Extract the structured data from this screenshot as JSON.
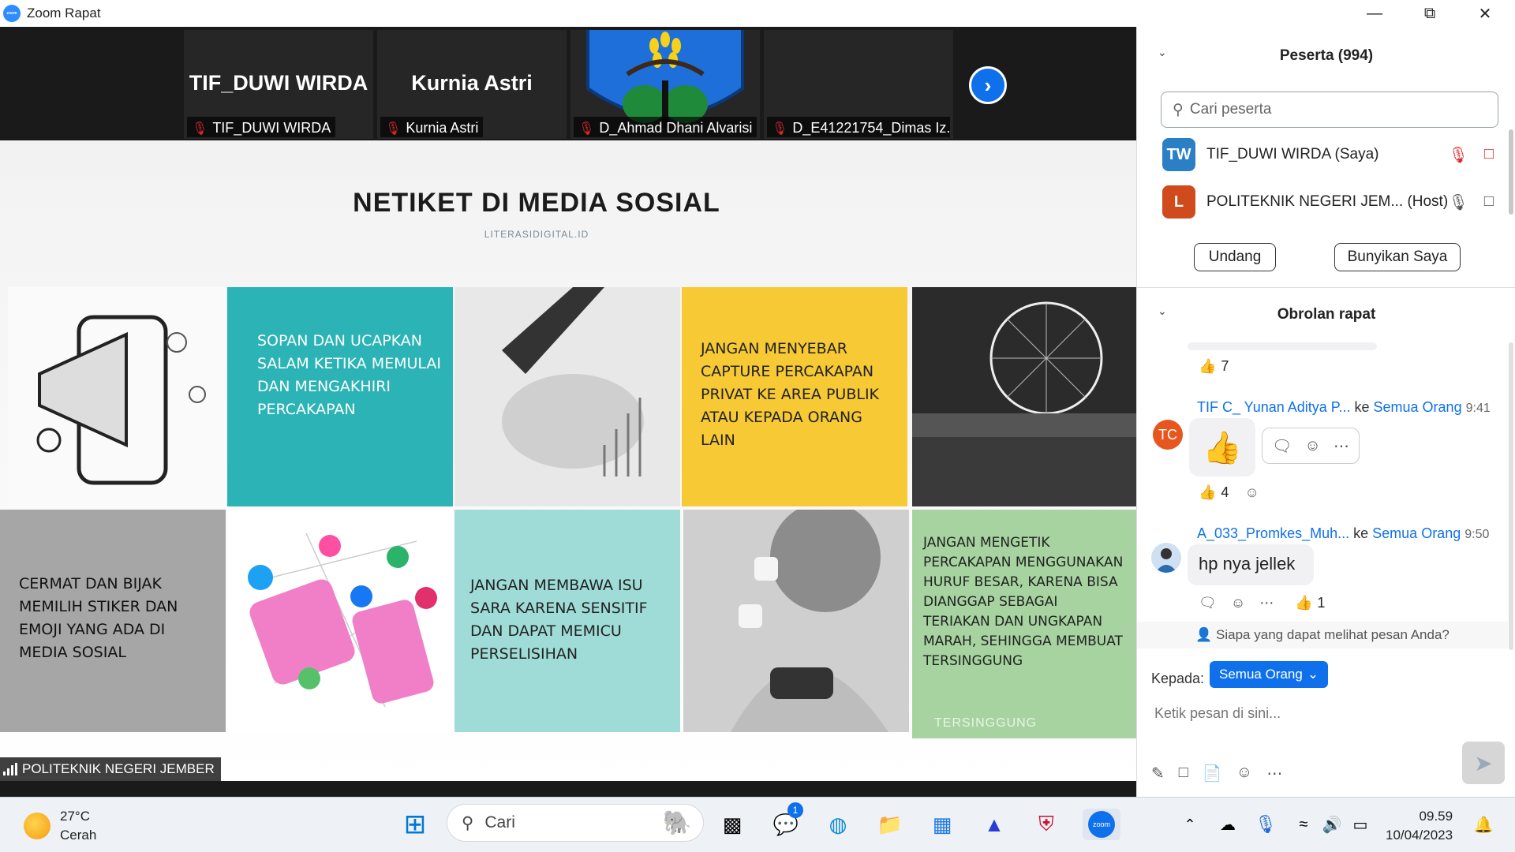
{
  "window": {
    "title": "Zoom Rapat",
    "logo_text": "zoom"
  },
  "video_strip": {
    "tiles": [
      {
        "display_name": "TIF_DUWI WIRDA",
        "label": "TIF_DUWI WIRDA"
      },
      {
        "display_name": "Kurnia Astri",
        "label": "Kurnia Astri"
      },
      {
        "display_name": "",
        "label": "D_Ahmad Dhani Alvarisi"
      },
      {
        "display_name": "",
        "label": "D_E41221754_Dimas Iz..."
      }
    ]
  },
  "slide": {
    "title": "NETIKET DI MEDIA SOSIAL",
    "subtitle": "LITERASIDIGITAL.ID",
    "tips": [
      "Sopan dan ucapkan salam ketika memulai dan mengakhiri percakapan",
      "Jangan menyebar capture percakapan privat ke area publik atau kepada orang lain",
      "Cermat dan bijak memilih stiker dan emoji yang ada di media sosial",
      "Jangan membawa isu SARA karena sensitif dan dapat memicu perselisihan",
      "Jangan mengetik percakapan menggunakan huruf besar, karena bisa dianggap sebagai teriakan dan ungkapan marah, sehingga membuat tersinggung"
    ],
    "watermark": "TERSINGGUNG",
    "speaker_label": "POLITEKNIK NEGERI JEMBER"
  },
  "participants": {
    "header": "Peserta (994)",
    "search_placeholder": "Cari peserta",
    "list": [
      {
        "initials": "TW",
        "name": "TIF_DUWI WIRDA (Saya)",
        "color": "#2b7fc4"
      },
      {
        "initials": "L",
        "name": "POLITEKNIK NEGERI JEM... (Host)",
        "color": "#d04a1b"
      }
    ],
    "invite_label": "Undang",
    "unmute_label": "Bunyikan Saya"
  },
  "chat": {
    "header": "Obrolan rapat",
    "messages": [
      {
        "reaction": "👍",
        "reaction_count": "7"
      },
      {
        "avatar": "TC",
        "sender": "TIF C_ Yunan Aditya P...",
        "to_word": "ke",
        "to": "Semua Orang",
        "time": "9:41",
        "content": "👍",
        "reaction": "👍",
        "reaction_count": "4"
      },
      {
        "sender": "A_033_Promkes_Muh...",
        "to_word": "ke",
        "to": "Semua Orang",
        "time": "9:50",
        "content": "hp nya jellek",
        "reaction": "👍",
        "reaction_count": "1"
      }
    ],
    "visibility_note": "Siapa yang dapat melihat pesan Anda?",
    "to_label": "Kepada:",
    "to_value": "Semua Orang",
    "input_placeholder": "Ketik pesan di sini..."
  },
  "taskbar": {
    "weather_temp": "27°C",
    "weather_desc": "Cerah",
    "search_placeholder": "Cari",
    "chat_badge": "1",
    "zoom_label": "zoom",
    "time": "09.59",
    "date": "10/04/2023"
  },
  "colors": {
    "accent": "#0e71eb",
    "teal": "#2bb3b5",
    "yellow": "#f7c935",
    "green": "#a6d3a0"
  }
}
